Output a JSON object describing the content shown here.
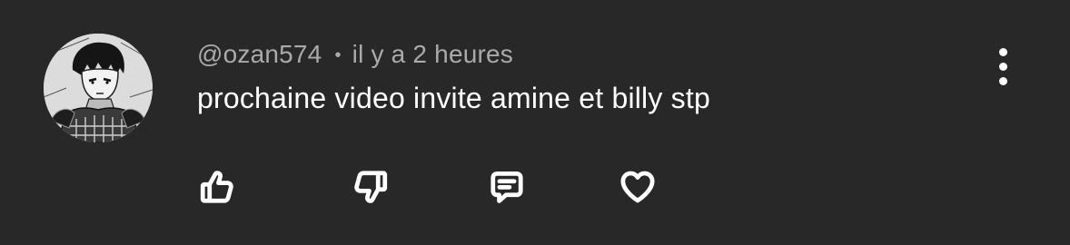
{
  "comment": {
    "author": "@ozan574",
    "separator": "•",
    "time": "il y a 2 heures",
    "text": "prochaine video invite amine et billy stp"
  },
  "actions": {
    "like_icon": "thumbs-up-icon",
    "dislike_icon": "thumbs-down-icon",
    "reply_icon": "comment-bubble-icon",
    "heart_icon": "heart-icon",
    "menu_icon": "more-vertical-icon"
  },
  "colors": {
    "background": "#282828",
    "text_primary": "#ffffff",
    "text_secondary": "#aaaaaa"
  }
}
